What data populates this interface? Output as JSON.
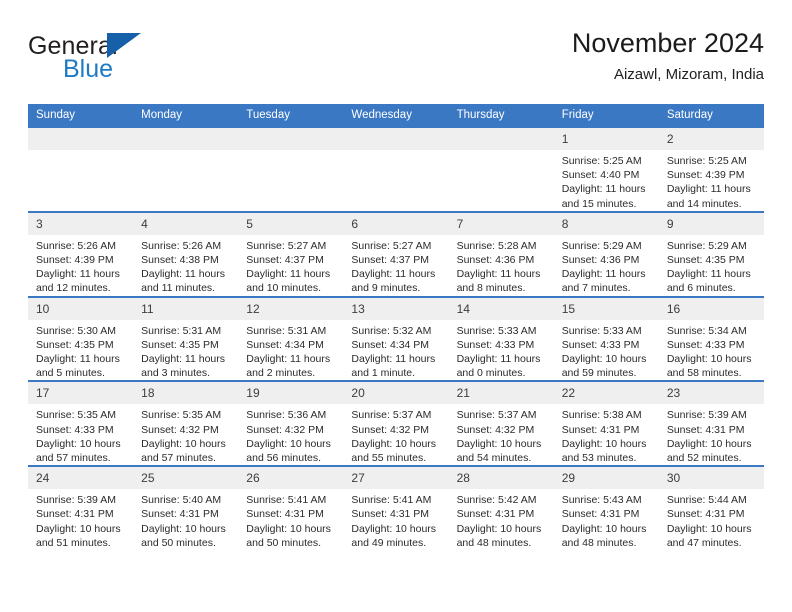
{
  "brand": {
    "name_top": "General",
    "name_bottom": "Blue",
    "triangle_color": "#1560a8",
    "blue_text_color": "#1f7ac4"
  },
  "header": {
    "title": "November 2024",
    "subtitle": "Aizawl, Mizoram, India"
  },
  "theme": {
    "header_blue": "#3b78c3",
    "daynum_band": "#efefef",
    "text": "#2b2b2b"
  },
  "weekday_headers": [
    "Sunday",
    "Monday",
    "Tuesday",
    "Wednesday",
    "Thursday",
    "Friday",
    "Saturday"
  ],
  "weeks": [
    [
      {
        "day": "",
        "blank": true
      },
      {
        "day": "",
        "blank": true
      },
      {
        "day": "",
        "blank": true
      },
      {
        "day": "",
        "blank": true
      },
      {
        "day": "",
        "blank": true
      },
      {
        "day": "1",
        "sunrise": "Sunrise: 5:25 AM",
        "sunset": "Sunset: 4:40 PM",
        "daylight": "Daylight: 11 hours and 15 minutes."
      },
      {
        "day": "2",
        "sunrise": "Sunrise: 5:25 AM",
        "sunset": "Sunset: 4:39 PM",
        "daylight": "Daylight: 11 hours and 14 minutes."
      }
    ],
    [
      {
        "day": "3",
        "sunrise": "Sunrise: 5:26 AM",
        "sunset": "Sunset: 4:39 PM",
        "daylight": "Daylight: 11 hours and 12 minutes."
      },
      {
        "day": "4",
        "sunrise": "Sunrise: 5:26 AM",
        "sunset": "Sunset: 4:38 PM",
        "daylight": "Daylight: 11 hours and 11 minutes."
      },
      {
        "day": "5",
        "sunrise": "Sunrise: 5:27 AM",
        "sunset": "Sunset: 4:37 PM",
        "daylight": "Daylight: 11 hours and 10 minutes."
      },
      {
        "day": "6",
        "sunrise": "Sunrise: 5:27 AM",
        "sunset": "Sunset: 4:37 PM",
        "daylight": "Daylight: 11 hours and 9 minutes."
      },
      {
        "day": "7",
        "sunrise": "Sunrise: 5:28 AM",
        "sunset": "Sunset: 4:36 PM",
        "daylight": "Daylight: 11 hours and 8 minutes."
      },
      {
        "day": "8",
        "sunrise": "Sunrise: 5:29 AM",
        "sunset": "Sunset: 4:36 PM",
        "daylight": "Daylight: 11 hours and 7 minutes."
      },
      {
        "day": "9",
        "sunrise": "Sunrise: 5:29 AM",
        "sunset": "Sunset: 4:35 PM",
        "daylight": "Daylight: 11 hours and 6 minutes."
      }
    ],
    [
      {
        "day": "10",
        "sunrise": "Sunrise: 5:30 AM",
        "sunset": "Sunset: 4:35 PM",
        "daylight": "Daylight: 11 hours and 5 minutes."
      },
      {
        "day": "11",
        "sunrise": "Sunrise: 5:31 AM",
        "sunset": "Sunset: 4:35 PM",
        "daylight": "Daylight: 11 hours and 3 minutes."
      },
      {
        "day": "12",
        "sunrise": "Sunrise: 5:31 AM",
        "sunset": "Sunset: 4:34 PM",
        "daylight": "Daylight: 11 hours and 2 minutes."
      },
      {
        "day": "13",
        "sunrise": "Sunrise: 5:32 AM",
        "sunset": "Sunset: 4:34 PM",
        "daylight": "Daylight: 11 hours and 1 minute."
      },
      {
        "day": "14",
        "sunrise": "Sunrise: 5:33 AM",
        "sunset": "Sunset: 4:33 PM",
        "daylight": "Daylight: 11 hours and 0 minutes."
      },
      {
        "day": "15",
        "sunrise": "Sunrise: 5:33 AM",
        "sunset": "Sunset: 4:33 PM",
        "daylight": "Daylight: 10 hours and 59 minutes."
      },
      {
        "day": "16",
        "sunrise": "Sunrise: 5:34 AM",
        "sunset": "Sunset: 4:33 PM",
        "daylight": "Daylight: 10 hours and 58 minutes."
      }
    ],
    [
      {
        "day": "17",
        "sunrise": "Sunrise: 5:35 AM",
        "sunset": "Sunset: 4:33 PM",
        "daylight": "Daylight: 10 hours and 57 minutes."
      },
      {
        "day": "18",
        "sunrise": "Sunrise: 5:35 AM",
        "sunset": "Sunset: 4:32 PM",
        "daylight": "Daylight: 10 hours and 57 minutes."
      },
      {
        "day": "19",
        "sunrise": "Sunrise: 5:36 AM",
        "sunset": "Sunset: 4:32 PM",
        "daylight": "Daylight: 10 hours and 56 minutes."
      },
      {
        "day": "20",
        "sunrise": "Sunrise: 5:37 AM",
        "sunset": "Sunset: 4:32 PM",
        "daylight": "Daylight: 10 hours and 55 minutes."
      },
      {
        "day": "21",
        "sunrise": "Sunrise: 5:37 AM",
        "sunset": "Sunset: 4:32 PM",
        "daylight": "Daylight: 10 hours and 54 minutes."
      },
      {
        "day": "22",
        "sunrise": "Sunrise: 5:38 AM",
        "sunset": "Sunset: 4:31 PM",
        "daylight": "Daylight: 10 hours and 53 minutes."
      },
      {
        "day": "23",
        "sunrise": "Sunrise: 5:39 AM",
        "sunset": "Sunset: 4:31 PM",
        "daylight": "Daylight: 10 hours and 52 minutes."
      }
    ],
    [
      {
        "day": "24",
        "sunrise": "Sunrise: 5:39 AM",
        "sunset": "Sunset: 4:31 PM",
        "daylight": "Daylight: 10 hours and 51 minutes."
      },
      {
        "day": "25",
        "sunrise": "Sunrise: 5:40 AM",
        "sunset": "Sunset: 4:31 PM",
        "daylight": "Daylight: 10 hours and 50 minutes."
      },
      {
        "day": "26",
        "sunrise": "Sunrise: 5:41 AM",
        "sunset": "Sunset: 4:31 PM",
        "daylight": "Daylight: 10 hours and 50 minutes."
      },
      {
        "day": "27",
        "sunrise": "Sunrise: 5:41 AM",
        "sunset": "Sunset: 4:31 PM",
        "daylight": "Daylight: 10 hours and 49 minutes."
      },
      {
        "day": "28",
        "sunrise": "Sunrise: 5:42 AM",
        "sunset": "Sunset: 4:31 PM",
        "daylight": "Daylight: 10 hours and 48 minutes."
      },
      {
        "day": "29",
        "sunrise": "Sunrise: 5:43 AM",
        "sunset": "Sunset: 4:31 PM",
        "daylight": "Daylight: 10 hours and 48 minutes."
      },
      {
        "day": "30",
        "sunrise": "Sunrise: 5:44 AM",
        "sunset": "Sunset: 4:31 PM",
        "daylight": "Daylight: 10 hours and 47 minutes."
      }
    ]
  ]
}
